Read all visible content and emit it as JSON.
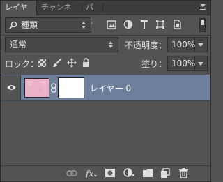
{
  "tabs": [
    {
      "label": "レイヤー",
      "active": true
    },
    {
      "label": "チャンネル",
      "active": false
    },
    {
      "label": "パス",
      "active": false
    }
  ],
  "filter": {
    "kind_value": "種類",
    "search_icon": "search-icon"
  },
  "blend": {
    "mode_value": "通常",
    "opacity_label": "不透明度：",
    "opacity_value": "100%"
  },
  "lock": {
    "label": "ロック：",
    "fill_label": "塗り：",
    "fill_value": "100%"
  },
  "layers": [
    {
      "name": "レイヤー 0",
      "visible": true,
      "selected": true
    }
  ],
  "colors": {
    "panel_bg": "#535353",
    "selection": "#6e7f9b",
    "tab_bar": "#3c3c3c"
  }
}
